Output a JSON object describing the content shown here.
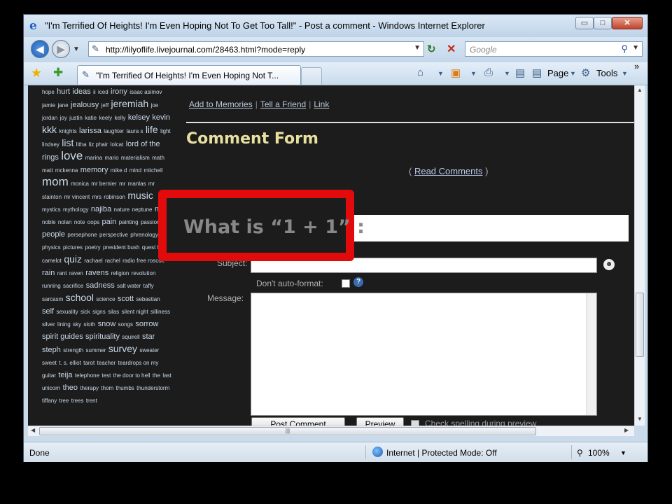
{
  "window": {
    "title": "\"I'm Terrified Of Heights! I'm Even Hoping Not To Get Too Tall!\" - Post a comment - Windows Internet Explorer",
    "min_glyph": "▭",
    "max_glyph": "□",
    "close_glyph": "✕"
  },
  "nav": {
    "url": "http://lilyoflife.livejournal.com/28463.html?mode=reply",
    "search_placeholder": "Google"
  },
  "tabs": {
    "active_label": "\"I'm Terrified Of Heights! I'm Even Hoping Not T..."
  },
  "command_bar": {
    "page_label": "Page",
    "tools_label": "Tools",
    "chevron": "»"
  },
  "tag_cloud": [
    {
      "t": "hope",
      "s": "s"
    },
    {
      "t": "hurt",
      "s": "m"
    },
    {
      "t": "ideas",
      "s": "m"
    },
    {
      "t": "ii",
      "s": "s"
    },
    {
      "t": "iced",
      "s": "s"
    },
    {
      "t": "irony",
      "s": "m"
    },
    {
      "t": "isaac asimov",
      "s": "s"
    },
    {
      "t": "jamie",
      "s": "s"
    },
    {
      "t": "jane",
      "s": "s"
    },
    {
      "t": "jealousy",
      "s": "m"
    },
    {
      "t": "jeff",
      "s": "s"
    },
    {
      "t": "jeremiah",
      "s": "l"
    },
    {
      "t": "joe",
      "s": "s"
    },
    {
      "t": "jordan",
      "s": "s"
    },
    {
      "t": "joy",
      "s": "s"
    },
    {
      "t": "justin",
      "s": "s"
    },
    {
      "t": "katie",
      "s": "s"
    },
    {
      "t": "keely",
      "s": "s"
    },
    {
      "t": "kelly",
      "s": "s"
    },
    {
      "t": "kelsey",
      "s": "m"
    },
    {
      "t": "kevin",
      "s": "m"
    },
    {
      "t": "kkk",
      "s": "l"
    },
    {
      "t": "knights",
      "s": "s"
    },
    {
      "t": "larissa",
      "s": "m"
    },
    {
      "t": "laughter",
      "s": "s"
    },
    {
      "t": "laura s",
      "s": "s"
    },
    {
      "t": "life",
      "s": "l"
    },
    {
      "t": "light",
      "s": "s"
    },
    {
      "t": "lindsey",
      "s": "s"
    },
    {
      "t": "list",
      "s": "l"
    },
    {
      "t": "litha",
      "s": "s"
    },
    {
      "t": "liz phair",
      "s": "s"
    },
    {
      "t": "lolcat",
      "s": "s"
    },
    {
      "t": "lord of the",
      "s": "m"
    },
    {
      "t": "rings",
      "s": "m"
    },
    {
      "t": "love",
      "s": "xl"
    },
    {
      "t": "marina",
      "s": "s"
    },
    {
      "t": "mario",
      "s": "s"
    },
    {
      "t": "materialism",
      "s": "s"
    },
    {
      "t": "math",
      "s": "s"
    },
    {
      "t": "matt",
      "s": "s"
    },
    {
      "t": "mckenna",
      "s": "s"
    },
    {
      "t": "memory",
      "s": "m"
    },
    {
      "t": "mike d",
      "s": "s"
    },
    {
      "t": "mind",
      "s": "s"
    },
    {
      "t": "mitchell",
      "s": "s"
    },
    {
      "t": "mom",
      "s": "xl"
    },
    {
      "t": "monica",
      "s": "s"
    },
    {
      "t": "mr bernier",
      "s": "s"
    },
    {
      "t": "mr",
      "s": "s"
    },
    {
      "t": "manlas",
      "s": "s"
    },
    {
      "t": "mr stainton",
      "s": "s"
    },
    {
      "t": "mr vincent",
      "s": "s"
    },
    {
      "t": "mrs",
      "s": "s"
    },
    {
      "t": "robinson",
      "s": "s"
    },
    {
      "t": "music",
      "s": "l"
    },
    {
      "t": "mystics",
      "s": "s"
    },
    {
      "t": "mythology",
      "s": "s"
    },
    {
      "t": "najiba",
      "s": "m"
    },
    {
      "t": "nature",
      "s": "s"
    },
    {
      "t": "neptune",
      "s": "s"
    },
    {
      "t": "ning",
      "s": "m"
    },
    {
      "t": "noble",
      "s": "s"
    },
    {
      "t": "nolan",
      "s": "s"
    },
    {
      "t": "note",
      "s": "s"
    },
    {
      "t": "oops",
      "s": "s"
    },
    {
      "t": "pain",
      "s": "m"
    },
    {
      "t": "painting",
      "s": "s"
    },
    {
      "t": "passion",
      "s": "s"
    },
    {
      "t": "people",
      "s": "m"
    },
    {
      "t": "persephone",
      "s": "s"
    },
    {
      "t": "perspective",
      "s": "s"
    },
    {
      "t": "phrenology",
      "s": "s"
    },
    {
      "t": "physics",
      "s": "s"
    },
    {
      "t": "pictures",
      "s": "s"
    },
    {
      "t": "poetry",
      "s": "s"
    },
    {
      "t": "president bush",
      "s": "s"
    },
    {
      "t": "quest for camelot",
      "s": "s"
    },
    {
      "t": "quiz",
      "s": "l"
    },
    {
      "t": "rachael",
      "s": "s"
    },
    {
      "t": "rachel",
      "s": "s"
    },
    {
      "t": "radio free roscoe",
      "s": "s"
    },
    {
      "t": "rain",
      "s": "m"
    },
    {
      "t": "rant",
      "s": "s"
    },
    {
      "t": "raven",
      "s": "s"
    },
    {
      "t": "ravens",
      "s": "m"
    },
    {
      "t": "religion",
      "s": "s"
    },
    {
      "t": "revolution",
      "s": "s"
    },
    {
      "t": "running",
      "s": "s"
    },
    {
      "t": "sacrifice",
      "s": "s"
    },
    {
      "t": "sadness",
      "s": "m"
    },
    {
      "t": "salt water",
      "s": "s"
    },
    {
      "t": "taffy",
      "s": "s"
    },
    {
      "t": "sarcasm",
      "s": "s"
    },
    {
      "t": "school",
      "s": "l"
    },
    {
      "t": "science",
      "s": "s"
    },
    {
      "t": "scott",
      "s": "m"
    },
    {
      "t": "sebastian",
      "s": "s"
    },
    {
      "t": "self",
      "s": "m"
    },
    {
      "t": "sexuality",
      "s": "s"
    },
    {
      "t": "sick",
      "s": "s"
    },
    {
      "t": "signs",
      "s": "s"
    },
    {
      "t": "silas",
      "s": "s"
    },
    {
      "t": "silent night",
      "s": "s"
    },
    {
      "t": "silliness",
      "s": "s"
    },
    {
      "t": "silver",
      "s": "s"
    },
    {
      "t": "lining",
      "s": "s"
    },
    {
      "t": "sky",
      "s": "s"
    },
    {
      "t": "sloth",
      "s": "s"
    },
    {
      "t": "snow",
      "s": "m"
    },
    {
      "t": "songs",
      "s": "s"
    },
    {
      "t": "sorrow",
      "s": "m"
    },
    {
      "t": "spirit guides",
      "s": "m"
    },
    {
      "t": "spirituality",
      "s": "m"
    },
    {
      "t": "squirell",
      "s": "s"
    },
    {
      "t": "star",
      "s": "m"
    },
    {
      "t": "steph",
      "s": "m"
    },
    {
      "t": "strength",
      "s": "s"
    },
    {
      "t": "summer",
      "s": "s"
    },
    {
      "t": "survey",
      "s": "l"
    },
    {
      "t": "sweater",
      "s": "s"
    },
    {
      "t": "sweet",
      "s": "s"
    },
    {
      "t": "t. s. elliot",
      "s": "s"
    },
    {
      "t": "tarot",
      "s": "s"
    },
    {
      "t": "teacher",
      "s": "s"
    },
    {
      "t": "teardrops on my guitar",
      "s": "s"
    },
    {
      "t": "teija",
      "s": "m"
    },
    {
      "t": "telephone",
      "s": "s"
    },
    {
      "t": "test",
      "s": "s"
    },
    {
      "t": "the door to hell",
      "s": "s"
    },
    {
      "t": "the",
      "s": "s"
    },
    {
      "t": "last unicorn",
      "s": "s"
    },
    {
      "t": "theo",
      "s": "m"
    },
    {
      "t": "therapy",
      "s": "s"
    },
    {
      "t": "thom",
      "s": "s"
    },
    {
      "t": "thumbs",
      "s": "s"
    },
    {
      "t": "thunderstorm",
      "s": "s"
    },
    {
      "t": "tiffany",
      "s": "s"
    },
    {
      "t": "tree",
      "s": "s"
    },
    {
      "t": "trees",
      "s": "s"
    },
    {
      "t": "trent",
      "s": "s"
    }
  ],
  "page": {
    "memory_links": [
      "Add to Memories",
      "Tell a Friend",
      "Link"
    ],
    "section_title": "Comment Form",
    "read_comments": {
      "open": "( ",
      "label": "Read Comments",
      "close": " )"
    },
    "subject_label": "Subject:",
    "dont_autoformat_label": "Don't auto-format:",
    "message_label": "Message:",
    "post_button": "Post Comment",
    "preview_button": "Preview",
    "spellcheck_label": "Check spelling during preview"
  },
  "callout": {
    "text": "What is “1 + 1” :",
    "border_color": "#e20b0b"
  },
  "status": {
    "left": "Done",
    "zone": "Internet | Protected Mode: Off",
    "zoom": "100%"
  }
}
